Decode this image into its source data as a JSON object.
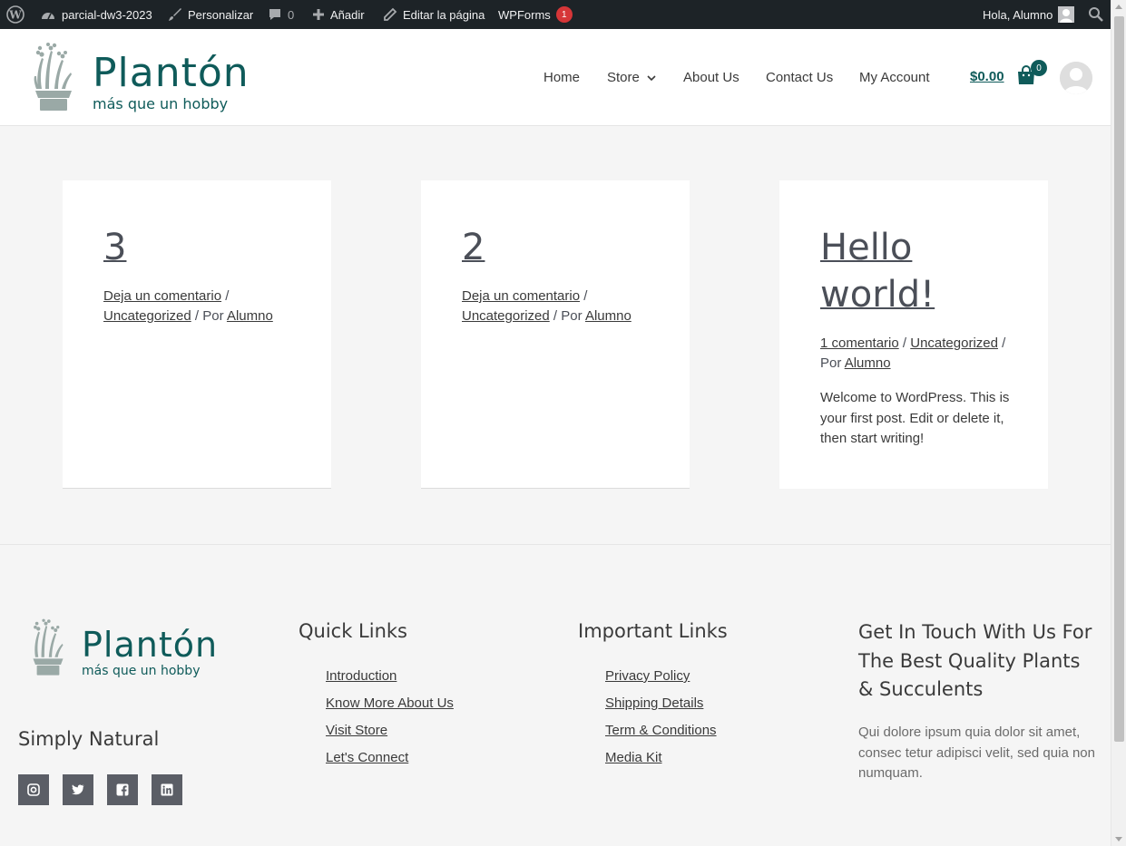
{
  "admin_bar": {
    "site_name": "parcial-dw3-2023",
    "customize": "Personalizar",
    "comments_count": "0",
    "add_new": "Añadir",
    "edit_page": "Editar la página",
    "wpforms": "WPForms",
    "wpforms_badge": "1",
    "greeting": "Hola, Alumno"
  },
  "header": {
    "brand_name": "Plantón",
    "brand_tagline": "más que un hobby",
    "nav": [
      "Home",
      "Store",
      "About Us",
      "Contact Us",
      "My Account"
    ],
    "cart_total": "$0.00",
    "cart_count": "0"
  },
  "posts": [
    {
      "title": "3",
      "comments_link": "Deja un comentario",
      "category": "Uncategorized",
      "by": "/ Por",
      "author": "Alumno",
      "excerpt": ""
    },
    {
      "title": "2",
      "comments_link": "Deja un comentario",
      "category": "Uncategorized",
      "by": "/ Por",
      "author": "Alumno",
      "excerpt": ""
    },
    {
      "title": "Hello world!",
      "comments_link": "1 comentario",
      "category": "Uncategorized",
      "by": "/ Por",
      "author": "Alumno",
      "excerpt": "Welcome to WordPress. This is your first post. Edit or delete it, then start writing!"
    }
  ],
  "footer": {
    "brand_name": "Plantón",
    "brand_tagline": "más que un hobby",
    "simply_natural": "Simply Natural",
    "quick_links_heading": "Quick Links",
    "quick_links": [
      "Introduction",
      "Know More About Us",
      "Visit Store",
      "Let's Connect"
    ],
    "important_links_heading": "Important Links",
    "important_links": [
      "Privacy Policy",
      "Shipping Details",
      "Term & Conditions",
      "Media Kit"
    ],
    "contact_heading": "Get In Touch With Us For The Best Quality Plants & Succulents",
    "contact_text": "Qui dolore ipsum quia dolor sit amet, consec tetur adipisci velit, sed quia non numquam.",
    "social_icons": [
      "instagram-icon",
      "twitter-icon",
      "facebook-icon",
      "linkedin-icon"
    ]
  },
  "colors": {
    "brand": "#0f5b5a",
    "admin_bar": "#1d2327",
    "badge": "#d63638"
  }
}
